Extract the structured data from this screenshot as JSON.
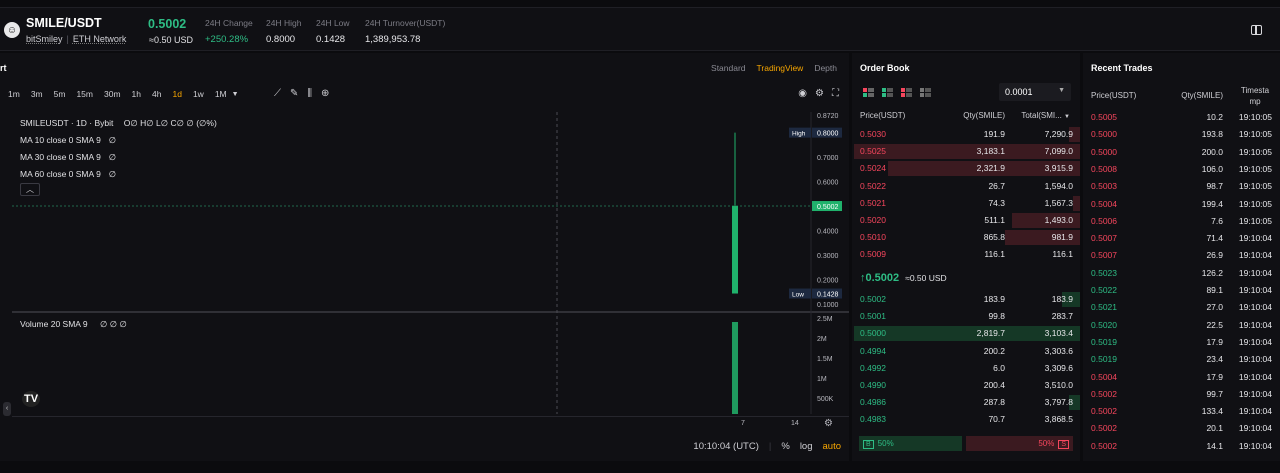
{
  "header": {
    "pair": "SMILE/USDT",
    "name": "bitSmiley",
    "network": "ETH Network",
    "last_price": "0.5002",
    "last_price_usd": "≈0.50 USD",
    "stats": [
      {
        "label": "24H Change",
        "value": "+250.28%",
        "positive": true
      },
      {
        "label": "24H High",
        "value": "0.8000",
        "positive": false
      },
      {
        "label": "24H Low",
        "value": "0.1428",
        "positive": false
      },
      {
        "label": "24H Turnover(USDT)",
        "value": "1,389,953.78",
        "positive": false
      }
    ]
  },
  "chart": {
    "title_fragment": "rt",
    "views": [
      "Standard",
      "TradingView",
      "Depth"
    ],
    "active_view": "TradingView",
    "timeframes": [
      "1m",
      "3m",
      "5m",
      "15m",
      "30m",
      "1h",
      "4h",
      "1d",
      "1w",
      "1M"
    ],
    "active_timeframe": "1d",
    "symbol_legend": "SMILEUSDT · 1D · Bybit",
    "ohlc": "O∅ H∅ L∅ C∅ ∅ (∅%)",
    "ma_lines": [
      "MA 10 close 0 SMA 9",
      "MA 30 close 0 SMA 9",
      "MA 60 close 0 SMA 9"
    ],
    "ma_value": "∅",
    "volume_legend": "Volume 20 SMA 9",
    "volume_values": "∅ ∅ ∅",
    "price_ticks": [
      "0.8720",
      "0.7000",
      "0.6000",
      "0.4000",
      "0.3000",
      "0.2000",
      "0.1000"
    ],
    "price_tick_values": [
      0.872,
      0.7,
      0.6,
      0.4,
      0.3,
      0.2,
      0.1
    ],
    "current_price_label": "0.5002",
    "current_price": 0.5002,
    "high_tag": "High",
    "high_value": "0.8000",
    "high": 0.8,
    "low_tag": "Low",
    "low_value": "0.1428",
    "low": 0.1428,
    "candle": {
      "open": 0.5002,
      "close": 0.1428,
      "high": 0.8,
      "low": 0.1428
    },
    "volume_ticks": [
      "2.5M",
      "2M",
      "1.5M",
      "1M",
      "500K"
    ],
    "volume_tick_values": [
      2500000,
      2000000,
      1500000,
      1000000,
      500000
    ],
    "volume_bar": 2400000,
    "x_ticks": [
      "7",
      "14"
    ],
    "clock": "10:10:04 (UTC)",
    "percent_label": "%",
    "log_label": "log",
    "auto_label": "auto",
    "tv_logo": "TV"
  },
  "order_book": {
    "title": "Order Book",
    "precision": "0.0001",
    "headers": {
      "price": "Price(USDT)",
      "qty": "Qty(SMILE)",
      "total": "Total(SMI..."
    },
    "asks": [
      {
        "price": "0.5030",
        "qty": "191.9",
        "total": "7,290.9",
        "depth": 0.05
      },
      {
        "price": "0.5025",
        "qty": "3,183.1",
        "total": "7,099.0",
        "depth": 1.0
      },
      {
        "price": "0.5024",
        "qty": "2,321.9",
        "total": "3,915.9",
        "depth": 0.85
      },
      {
        "price": "0.5022",
        "qty": "26.7",
        "total": "1,594.0",
        "depth": 0.0
      },
      {
        "price": "0.5021",
        "qty": "74.3",
        "total": "1,567.3",
        "depth": 0.03
      },
      {
        "price": "0.5020",
        "qty": "511.1",
        "total": "1,493.0",
        "depth": 0.3
      },
      {
        "price": "0.5010",
        "qty": "865.8",
        "total": "981.9",
        "depth": 0.33
      },
      {
        "price": "0.5009",
        "qty": "116.1",
        "total": "116.1",
        "depth": 0.0
      }
    ],
    "mid_price": "0.5002",
    "mid_usd": "≈0.50 USD",
    "bids": [
      {
        "price": "0.5002",
        "qty": "183.9",
        "total": "183.9",
        "depth": 0.08
      },
      {
        "price": "0.5001",
        "qty": "99.8",
        "total": "283.7",
        "depth": 0.0
      },
      {
        "price": "0.5000",
        "qty": "2,819.7",
        "total": "3,103.4",
        "depth": 1.0
      },
      {
        "price": "0.4994",
        "qty": "200.2",
        "total": "3,303.6",
        "depth": 0.0
      },
      {
        "price": "0.4992",
        "qty": "6.0",
        "total": "3,309.6",
        "depth": 0.0
      },
      {
        "price": "0.4990",
        "qty": "200.4",
        "total": "3,510.0",
        "depth": 0.0
      },
      {
        "price": "0.4986",
        "qty": "287.8",
        "total": "3,797.8",
        "depth": 0.05
      },
      {
        "price": "0.4983",
        "qty": "70.7",
        "total": "3,868.5",
        "depth": 0.0
      }
    ],
    "buy_ratio": "50%",
    "sell_ratio": "50%",
    "buy_tag": "B",
    "sell_tag": "S"
  },
  "recent_trades": {
    "title": "Recent Trades",
    "headers": {
      "price": "Price(USDT)",
      "qty": "Qty(SMILE)",
      "time": "Timestamp"
    },
    "rows": [
      {
        "price": "0.5005",
        "qty": "10.2",
        "time": "19:10:05",
        "side": "sell"
      },
      {
        "price": "0.5000",
        "qty": "193.8",
        "time": "19:10:05",
        "side": "sell"
      },
      {
        "price": "0.5000",
        "qty": "200.0",
        "time": "19:10:05",
        "side": "sell"
      },
      {
        "price": "0.5008",
        "qty": "106.0",
        "time": "19:10:05",
        "side": "sell"
      },
      {
        "price": "0.5003",
        "qty": "98.7",
        "time": "19:10:05",
        "side": "sell"
      },
      {
        "price": "0.5004",
        "qty": "199.4",
        "time": "19:10:05",
        "side": "sell"
      },
      {
        "price": "0.5006",
        "qty": "7.6",
        "time": "19:10:05",
        "side": "sell"
      },
      {
        "price": "0.5007",
        "qty": "71.4",
        "time": "19:10:04",
        "side": "sell"
      },
      {
        "price": "0.5007",
        "qty": "26.9",
        "time": "19:10:04",
        "side": "sell"
      },
      {
        "price": "0.5023",
        "qty": "126.2",
        "time": "19:10:04",
        "side": "buy"
      },
      {
        "price": "0.5022",
        "qty": "89.1",
        "time": "19:10:04",
        "side": "buy"
      },
      {
        "price": "0.5021",
        "qty": "27.0",
        "time": "19:10:04",
        "side": "buy"
      },
      {
        "price": "0.5020",
        "qty": "22.5",
        "time": "19:10:04",
        "side": "buy"
      },
      {
        "price": "0.5019",
        "qty": "17.9",
        "time": "19:10:04",
        "side": "buy"
      },
      {
        "price": "0.5019",
        "qty": "23.4",
        "time": "19:10:04",
        "side": "buy"
      },
      {
        "price": "0.5004",
        "qty": "17.9",
        "time": "19:10:04",
        "side": "sell"
      },
      {
        "price": "0.5002",
        "qty": "99.7",
        "time": "19:10:04",
        "side": "sell"
      },
      {
        "price": "0.5002",
        "qty": "133.4",
        "time": "19:10:04",
        "side": "sell"
      },
      {
        "price": "0.5002",
        "qty": "20.1",
        "time": "19:10:04",
        "side": "sell"
      },
      {
        "price": "0.5002",
        "qty": "14.1",
        "time": "19:10:04",
        "side": "sell"
      }
    ]
  },
  "colors": {
    "up": "#2ebd85",
    "down": "#f6465d",
    "accent": "#f7a600"
  }
}
